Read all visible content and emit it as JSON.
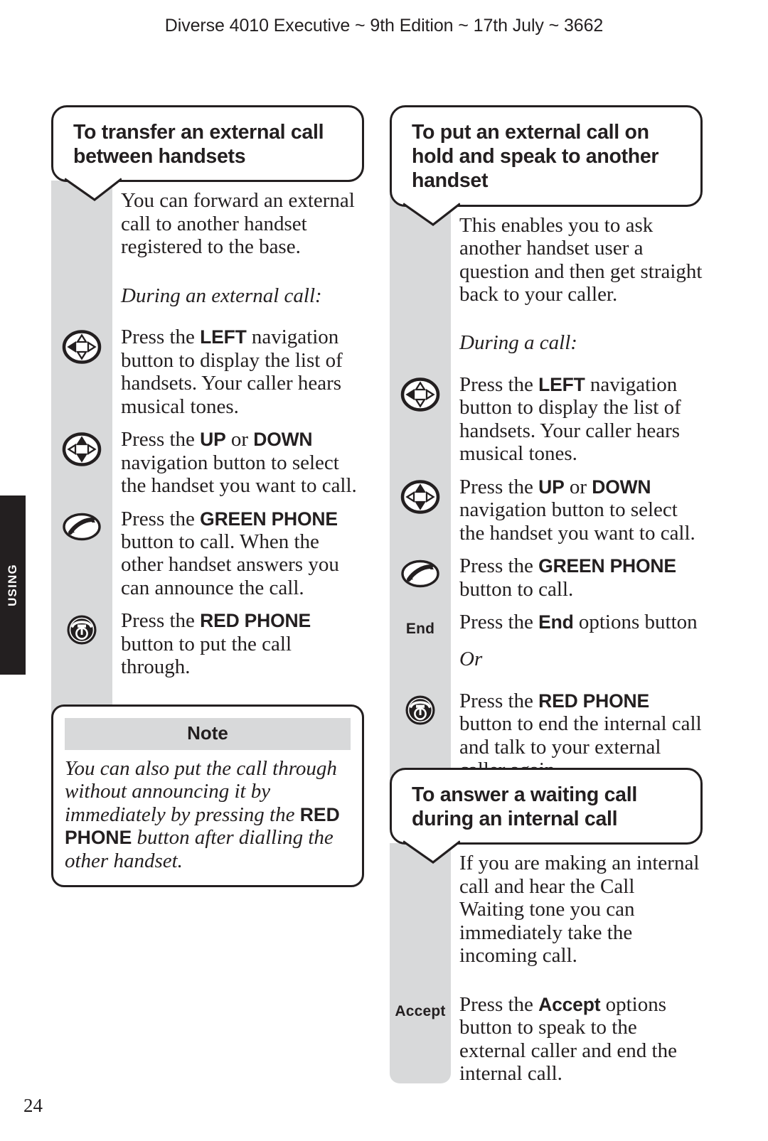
{
  "header": {
    "running_head": "Diverse 4010 Executive ~ 9th Edition ~ 17th July ~ 3662"
  },
  "side_tab": {
    "label": "USING"
  },
  "page_number": "24",
  "sections": [
    {
      "id": "transfer-external-call",
      "heading": "To transfer an external call between handsets",
      "intro": "You can forward an external call to another handset registered to the base.",
      "cue": "During an external call:",
      "steps": [
        {
          "icon": "nav-left-icon",
          "text_plain": "Press the LEFT navigation button to display the list of handsets. Your caller hears musical tones.",
          "pre": "Press the ",
          "strong": "LEFT",
          "post": " navigation button to display the list of handsets. Your caller hears musical tones."
        },
        {
          "icon": "nav-up-down-icon",
          "text_plain": "Press the UP or DOWN navigation button to select the handset you want to call.",
          "pre": "Press the ",
          "strong": "UP",
          "mid": " or ",
          "strong2": "DOWN",
          "post": " navigation button to select the handset you want to call."
        },
        {
          "icon": "green-phone-icon",
          "text_plain": "Press the GREEN PHONE button to call. When the other handset answers you can announce the call.",
          "pre": "Press the ",
          "strong": "GREEN PHONE",
          "post": " button to call. When the other handset answers you can announce the call."
        },
        {
          "icon": "red-phone-icon",
          "text_plain": "Press the RED PHONE button to put the call through.",
          "pre": "Press the ",
          "strong": "RED PHONE",
          "post": " button to put the call through."
        }
      ]
    },
    {
      "id": "hold-and-speak",
      "heading": "To put an external call on hold and speak to another handset",
      "intro": "This enables you to ask another handset user a question and then get straight back to your caller.",
      "cue": "During a call:",
      "steps": [
        {
          "icon": "nav-left-icon",
          "text_plain": "Press the LEFT navigation button to display the list of handsets. Your caller hears musical tones.",
          "pre": "Press the ",
          "strong": "LEFT",
          "post": " navigation button to display the list of handsets. Your caller hears musical tones."
        },
        {
          "icon": "nav-up-down-icon",
          "text_plain": "Press the UP or DOWN navigation button to select the handset you want to call.",
          "pre": "Press the ",
          "strong": "UP",
          "mid": " or ",
          "strong2": "DOWN",
          "post": " navigation button to select the handset you want to call."
        },
        {
          "icon": "green-phone-icon",
          "text_plain": "Press the GREEN PHONE button to call.",
          "pre": "Press the ",
          "strong": "GREEN PHONE",
          "post": " button to call."
        },
        {
          "icon": "text-label",
          "icon_label": "End",
          "text_plain": "Press the End options button",
          "pre": "Press the ",
          "strong": "End",
          "post": " options button"
        },
        {
          "icon": "none",
          "or": "Or"
        },
        {
          "icon": "red-phone-icon",
          "text_plain": "Press the RED PHONE button to end the internal call and talk to your external caller again.",
          "pre": "Press the ",
          "strong": "RED PHONE",
          "post": " button to end the internal call and talk to your external caller again."
        }
      ]
    },
    {
      "id": "answer-waiting-call",
      "heading": "To answer a waiting call during an internal call",
      "intro": "If you are making an internal call and hear the Call Waiting tone you can immediately take the incoming call.",
      "steps": [
        {
          "icon": "text-label",
          "icon_label": "Accept",
          "text_plain": "Press the Accept options button to speak to the external caller and end the internal call.",
          "pre": "Press the ",
          "strong": "Accept",
          "post": " options button to speak to the external caller and end the internal call."
        }
      ]
    }
  ],
  "note": {
    "title": "Note",
    "pre": "You can also put the call through without announcing it by immediately by pressing the ",
    "strong": "RED PHONE",
    "post": " button after dialling the other handset.",
    "text_plain": "You can also put the call through without announcing it by immediately by pressing the RED PHONE button after dialling the other handset."
  },
  "colors": {
    "ink": "#231f20",
    "gutter_grey": "#d8d9da",
    "page_white": "#ffffff"
  }
}
